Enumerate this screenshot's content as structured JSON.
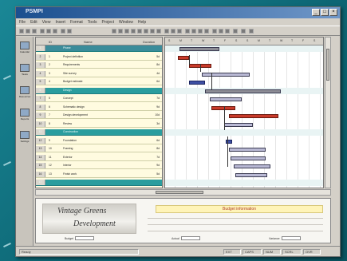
{
  "app": {
    "title": "PSMPI",
    "window_buttons": [
      "_",
      "□",
      "×"
    ]
  },
  "menu": [
    "File",
    "Edit",
    "View",
    "Insert",
    "Format",
    "Tools",
    "Project",
    "Window",
    "Help"
  ],
  "left_nav": [
    {
      "label": "Calendar",
      "icon": "calendar-icon"
    },
    {
      "label": "Tasks",
      "icon": "tasks-icon"
    },
    {
      "label": "Resources",
      "icon": "resources-icon"
    },
    {
      "label": "Reports",
      "icon": "reports-icon"
    },
    {
      "label": "Settings",
      "icon": "settings-icon"
    }
  ],
  "grid": {
    "headers": [
      "ID",
      "Name",
      "Duration"
    ],
    "rows": [
      {
        "n": "1",
        "id": "",
        "name": "Phase",
        "dur": "",
        "band": true,
        "first": true
      },
      {
        "n": "2",
        "id": "1",
        "name": "Project definition",
        "dur": "5d",
        "band": false
      },
      {
        "n": "3",
        "id": "2",
        "name": "Requirements",
        "dur": "8d",
        "band": false
      },
      {
        "n": "4",
        "id": "3",
        "name": "Site survey",
        "dur": "4d",
        "band": false
      },
      {
        "n": "5",
        "id": "4",
        "name": "Budget estimate",
        "dur": "6d",
        "band": false
      },
      {
        "n": "6",
        "id": "",
        "name": "Design",
        "dur": "",
        "band": true
      },
      {
        "n": "7",
        "id": "5",
        "name": "Concept",
        "dur": "7d",
        "band": false
      },
      {
        "n": "8",
        "id": "6",
        "name": "Schematic design",
        "dur": "9d",
        "band": false
      },
      {
        "n": "9",
        "id": "7",
        "name": "Design development",
        "dur": "10d",
        "band": false
      },
      {
        "n": "10",
        "id": "8",
        "name": "Review",
        "dur": "3d",
        "band": false
      },
      {
        "n": "11",
        "id": "",
        "name": "Construction",
        "dur": "",
        "band": true
      },
      {
        "n": "12",
        "id": "9",
        "name": "Foundation",
        "dur": "6d",
        "band": false
      },
      {
        "n": "13",
        "id": "10",
        "name": "Framing",
        "dur": "8d",
        "band": false
      },
      {
        "n": "14",
        "id": "11",
        "name": "Exterior",
        "dur": "7d",
        "band": false
      },
      {
        "n": "15",
        "id": "12",
        "name": "Interior",
        "dur": "9d",
        "band": false
      },
      {
        "n": "16",
        "id": "13",
        "name": "Finish work",
        "dur": "5d",
        "band": false
      },
      {
        "n": "17",
        "id": "",
        "name": "",
        "dur": "",
        "band": true
      }
    ]
  },
  "gantt": {
    "ticks": [
      "S",
      "M",
      "T",
      "W",
      "T",
      "F",
      "S",
      "S",
      "M",
      "T",
      "W",
      "T",
      "F",
      "S"
    ]
  },
  "bottom": {
    "logo_line1": "Vintage Greens",
    "logo_line2": "Development",
    "banner": "Budget information",
    "fields": [
      "Budget",
      "Actual",
      "Variance"
    ]
  },
  "status": [
    "Ready",
    "EXT",
    "CAPS",
    "NUM",
    "SCRL",
    "OVR"
  ]
}
